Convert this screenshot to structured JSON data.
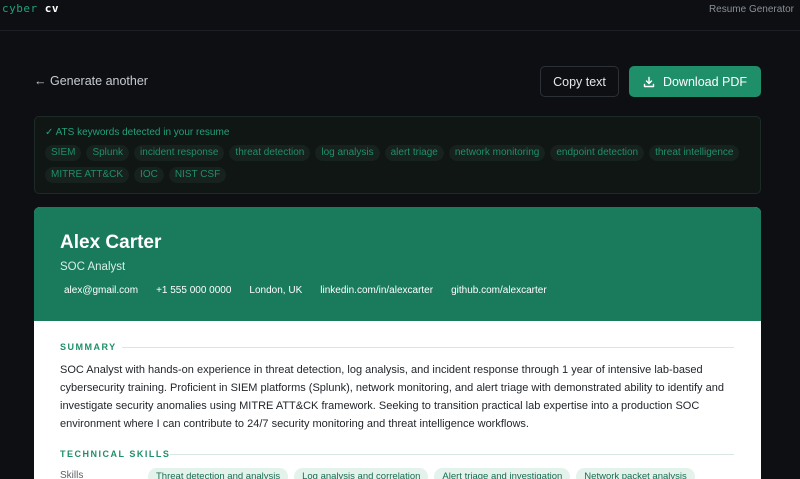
{
  "app": {
    "logo_a": "cyber",
    "logo_b": "cv",
    "nav_right": "Resume Generator"
  },
  "toolbar": {
    "back_label": "← Generate another",
    "copy_label": "Copy text",
    "pdf_label": "Download PDF"
  },
  "ats": {
    "title": "✓ ATS keywords detected in your resume",
    "keywords": [
      "SIEM",
      "Splunk",
      "incident response",
      "threat detection",
      "log analysis",
      "alert triage",
      "network monitoring",
      "endpoint detection",
      "threat intelligence",
      "MITRE ATT&CK",
      "IOC",
      "NIST CSF"
    ]
  },
  "resume": {
    "name": "Alex Carter",
    "role": "SOC Analyst",
    "contacts": [
      "alex@gmail.com",
      "+1 555 000 0000",
      "London, UK",
      "linkedin.com/in/alexcarter",
      "github.com/alexcarter"
    ],
    "summary_title": "SUMMARY",
    "summary": "SOC Analyst with hands-on experience in threat detection, log analysis, and incident response through 1 year of intensive lab-based cybersecurity training. Proficient in SIEM platforms (Splunk), network monitoring, and alert triage with demonstrated ability to identify and investigate security anomalies using MITRE ATT&CK framework. Seeking to transition practical lab expertise into a production SOC environment where I can contribute to 24/7 security monitoring and threat intelligence workflows.",
    "skills_title": "TECHNICAL SKILLS",
    "skills_label": "Skills",
    "skills": [
      "Threat detection and analysis",
      "Log analysis and correlation",
      "Alert triage and investigation",
      "Network packet analysis"
    ]
  },
  "colors": {
    "accent": "#1f8f6a",
    "header": "#1a7a5c",
    "background": "#0d0f12"
  }
}
